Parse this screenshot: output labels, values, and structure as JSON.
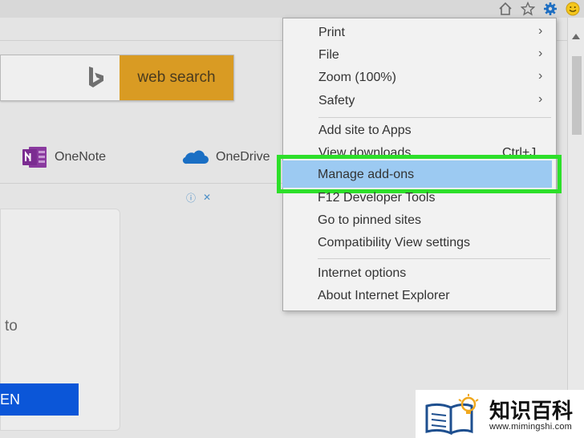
{
  "toolbar": {
    "icons": [
      "home-icon",
      "star-icon",
      "gear-icon",
      "smiley-icon"
    ]
  },
  "search": {
    "button_label": "web search"
  },
  "apps": [
    {
      "name": "OneNote",
      "icon": "onenote-icon"
    },
    {
      "name": "OneDrive",
      "icon": "onedrive-icon"
    }
  ],
  "ad_controls": {
    "info_icon": "info-icon",
    "close_icon": "close-icon",
    "info_glyph": "ⓘ",
    "close_glyph": "✕"
  },
  "card": {
    "text": "to",
    "button_label": "EN"
  },
  "tools_menu": {
    "items": [
      {
        "label": "Print",
        "submenu": true
      },
      {
        "label": "File",
        "submenu": true
      },
      {
        "label": "Zoom (100%)",
        "submenu": true
      },
      {
        "label": "Safety",
        "submenu": true
      },
      {
        "label": "Add site to Apps"
      },
      {
        "label": "View downloads",
        "shortcut": "Ctrl+J"
      },
      {
        "label": "Manage add-ons",
        "highlighted": true
      },
      {
        "label": "F12 Developer Tools"
      },
      {
        "label": "Go to pinned sites"
      },
      {
        "label": "Compatibility View settings"
      },
      {
        "label": "Internet options"
      },
      {
        "label": "About Internet Explorer"
      }
    ],
    "submenu_glyph": "›"
  },
  "watermark": {
    "title": "知识百科",
    "url": "www.mimingshi.com"
  },
  "colors": {
    "search_button": "#d99b23",
    "highlight_border": "#2ddf2a",
    "highlight_fill": "#9ccaf2",
    "card_button": "#0b56d8"
  }
}
